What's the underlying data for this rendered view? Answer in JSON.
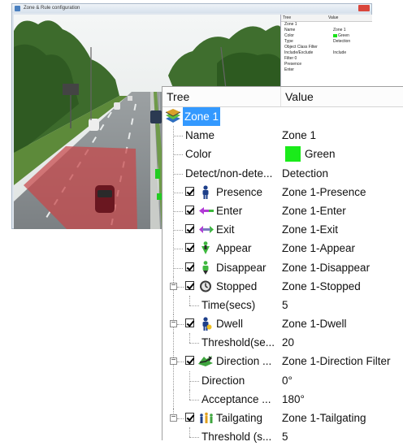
{
  "background_window": {
    "title": "Zone & Rule configuration",
    "mini_panel": {
      "header": [
        "Tree",
        "Value"
      ],
      "rows": [
        {
          "k": "Zone 1",
          "v": ""
        },
        {
          "k": "Name",
          "v": "Zone 1"
        },
        {
          "k": "Color",
          "v": "Green"
        },
        {
          "k": "Type",
          "v": "Detection"
        },
        {
          "k": "Object Class Filter",
          "v": ""
        },
        {
          "k": "Include/Exclude",
          "v": "Include"
        },
        {
          "k": "Filter 0",
          "v": ""
        },
        {
          "k": "Presence",
          "v": ""
        },
        {
          "k": "Enter",
          "v": ""
        }
      ]
    }
  },
  "tree": {
    "header_tree": "Tree",
    "header_value": "Value",
    "zone_label": "Zone 1",
    "rows": [
      {
        "label": "Name",
        "value": "Zone 1"
      },
      {
        "label": "Color",
        "value": "Green",
        "swatch": "#1aeb1a"
      },
      {
        "label": "Detect/non-dete...",
        "value": "Detection"
      },
      {
        "label": "Presence",
        "value": "Zone 1-Presence",
        "icon": "presence-icon"
      },
      {
        "label": "Enter",
        "value": "Zone 1-Enter",
        "icon": "enter-icon"
      },
      {
        "label": "Exit",
        "value": "Zone 1-Exit",
        "icon": "exit-icon"
      },
      {
        "label": "Appear",
        "value": "Zone 1-Appear",
        "icon": "appear-icon"
      },
      {
        "label": "Disappear",
        "value": "Zone 1-Disappear",
        "icon": "disappear-icon"
      },
      {
        "label": "Stopped",
        "value": "Zone 1-Stopped",
        "icon": "stopped-icon"
      },
      {
        "label": "Time(secs)",
        "value": "5"
      },
      {
        "label": "Dwell",
        "value": "Zone 1-Dwell",
        "icon": "dwell-icon"
      },
      {
        "label": "Threshold(se...",
        "value": "20"
      },
      {
        "label": "Direction ...",
        "value": "Zone 1-Direction Filter",
        "icon": "direction-icon"
      },
      {
        "label": "Direction",
        "value": "0°"
      },
      {
        "label": "Acceptance ...",
        "value": "180°"
      },
      {
        "label": "Tailgating",
        "value": "Zone 1-Tailgating",
        "icon": "tailgating-icon"
      },
      {
        "label": "Threshold (s...",
        "value": "5"
      }
    ]
  }
}
